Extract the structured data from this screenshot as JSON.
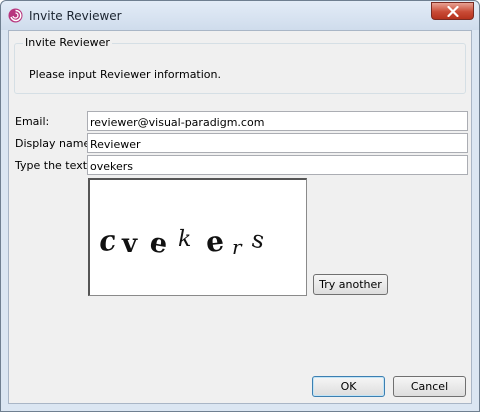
{
  "window": {
    "title": "Invite Reviewer"
  },
  "group": {
    "title": "Invite Reviewer",
    "message": "Please input Reviewer information."
  },
  "form": {
    "email_label": "Email:",
    "email_value": "reviewer@visual-paradigm.com",
    "display_name_label": "Display name:",
    "display_name_value": "Reviewer",
    "captcha_label": "Type the text:",
    "captcha_value": "ovekers"
  },
  "captcha": {
    "text": "cvekers"
  },
  "buttons": {
    "try_another": "Try another",
    "ok": "OK",
    "cancel": "Cancel"
  },
  "icons": {
    "app": "visual-paradigm-logo-icon",
    "close": "close-icon"
  },
  "colors": {
    "close_button": "#c94b36",
    "app_icon": "#b8367e"
  }
}
